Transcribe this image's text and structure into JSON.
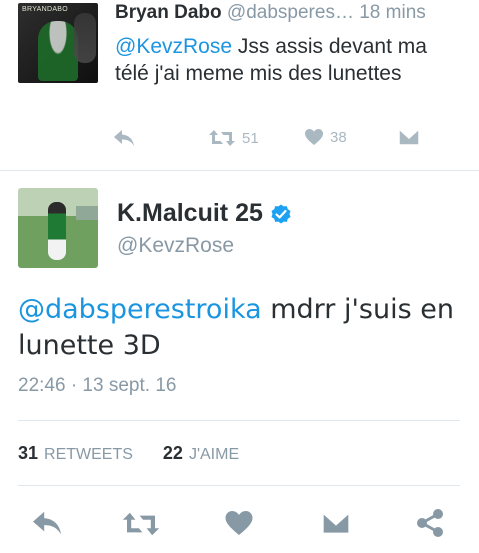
{
  "tweet1": {
    "avatar_text": "BRYANDABO",
    "name": "Bryan Dabo",
    "handle": "@dabsperes…",
    "time": "18 mins",
    "mention": "@KevzRose",
    "text": " Jss assis devant ma télé j'ai meme mis des lunettes",
    "retweets": "51",
    "likes": "38"
  },
  "tweet2": {
    "name": "K.Malcuit 25",
    "handle": "@KevzRose",
    "mention": "@dabsperestroika",
    "text": " mdrr j'suis en lunette 3D",
    "timestamp": "22:46 · 13 sept. 16",
    "retweets_count": "31",
    "retweets_label": "RETWEETS",
    "likes_count": "22",
    "likes_label": "J'AIME"
  },
  "colors": {
    "accent": "#1b95e0",
    "verified": "#1da1f2",
    "muted": "#8899a6",
    "icon": "#8899a6"
  },
  "icons": [
    "reply-icon",
    "retweet-icon",
    "like-icon",
    "dm-icon",
    "share-icon",
    "verified-badge-icon"
  ]
}
